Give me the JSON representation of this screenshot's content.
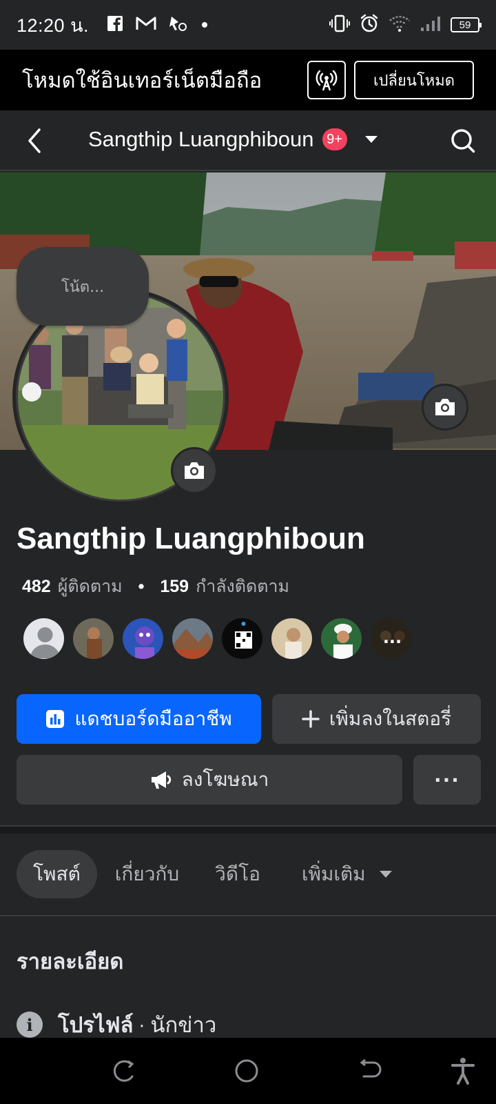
{
  "status_bar": {
    "time": "12:20 น.",
    "battery": "59",
    "left_icons": [
      "facebook-icon",
      "gmail-icon",
      "app-notification-icon",
      "dot-icon"
    ],
    "right_icons": [
      "vibrate-icon",
      "alarm-icon",
      "wifi-icon",
      "signal-icon"
    ]
  },
  "mode_banner": {
    "text": "โหมดใช้อินเทอร์เน็ตมือถือ",
    "switch_label": "เปลี่ยนโหมด",
    "icon": "broadcast-icon"
  },
  "header": {
    "title": "Sangthip Luangphiboun",
    "badge": "9+"
  },
  "profile": {
    "note_placeholder": "โน้ต...",
    "name": "Sangthip Luangphiboun",
    "followers_count": "482",
    "followers_label": "ผู้ติดตาม",
    "following_count": "159",
    "following_label": "กำลังติดตาม",
    "separator": "•"
  },
  "friends": {
    "more": "..."
  },
  "actions": {
    "dashboard": "แดชบอร์ดมืออาชีพ",
    "add_story": "เพิ่มลงในสตอรี่",
    "advertise": "ลงโฆษณา",
    "more": "···"
  },
  "tabs": [
    {
      "label": "โพสต์"
    },
    {
      "label": "เกี่ยวกับ"
    },
    {
      "label": "วิดีโอ"
    },
    {
      "label": "เพิ่มเติม"
    }
  ],
  "details": {
    "title": "รายละเอียด",
    "profile_label": "โปรไฟล์",
    "profile_sep": " · ",
    "profile_value": "นักข่าว"
  },
  "colors": {
    "background": "#242526",
    "primary": "#0866ff",
    "secondary_button": "#3a3b3c",
    "badge": "#f3425f"
  }
}
